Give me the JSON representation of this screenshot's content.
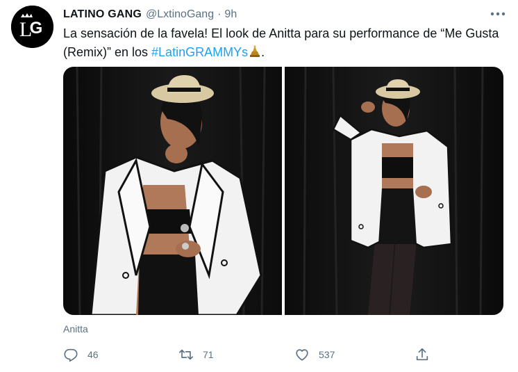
{
  "tweet": {
    "display_name": "LATINO GANG",
    "handle": "@LxtinoGang",
    "separator": "·",
    "time": "9h",
    "text_before": "La sensación de la favela! El look de Anitta para su performance de “Me Gusta (Remix)” en los ",
    "hashtag": "#LatinGRAMMYs",
    "text_after": ".",
    "avatar_initials": "LG",
    "tagged_person": "Anitta"
  },
  "media": {
    "photos": [
      {
        "subject": "anitta-closeup-photo"
      },
      {
        "subject": "anitta-fullbody-photo"
      }
    ]
  },
  "actions": {
    "replies": "46",
    "retweets": "71",
    "likes": "537"
  },
  "colors": {
    "accent": "#1da1f2",
    "secondary_text": "#5b7083",
    "primary_text": "#0f1419"
  }
}
